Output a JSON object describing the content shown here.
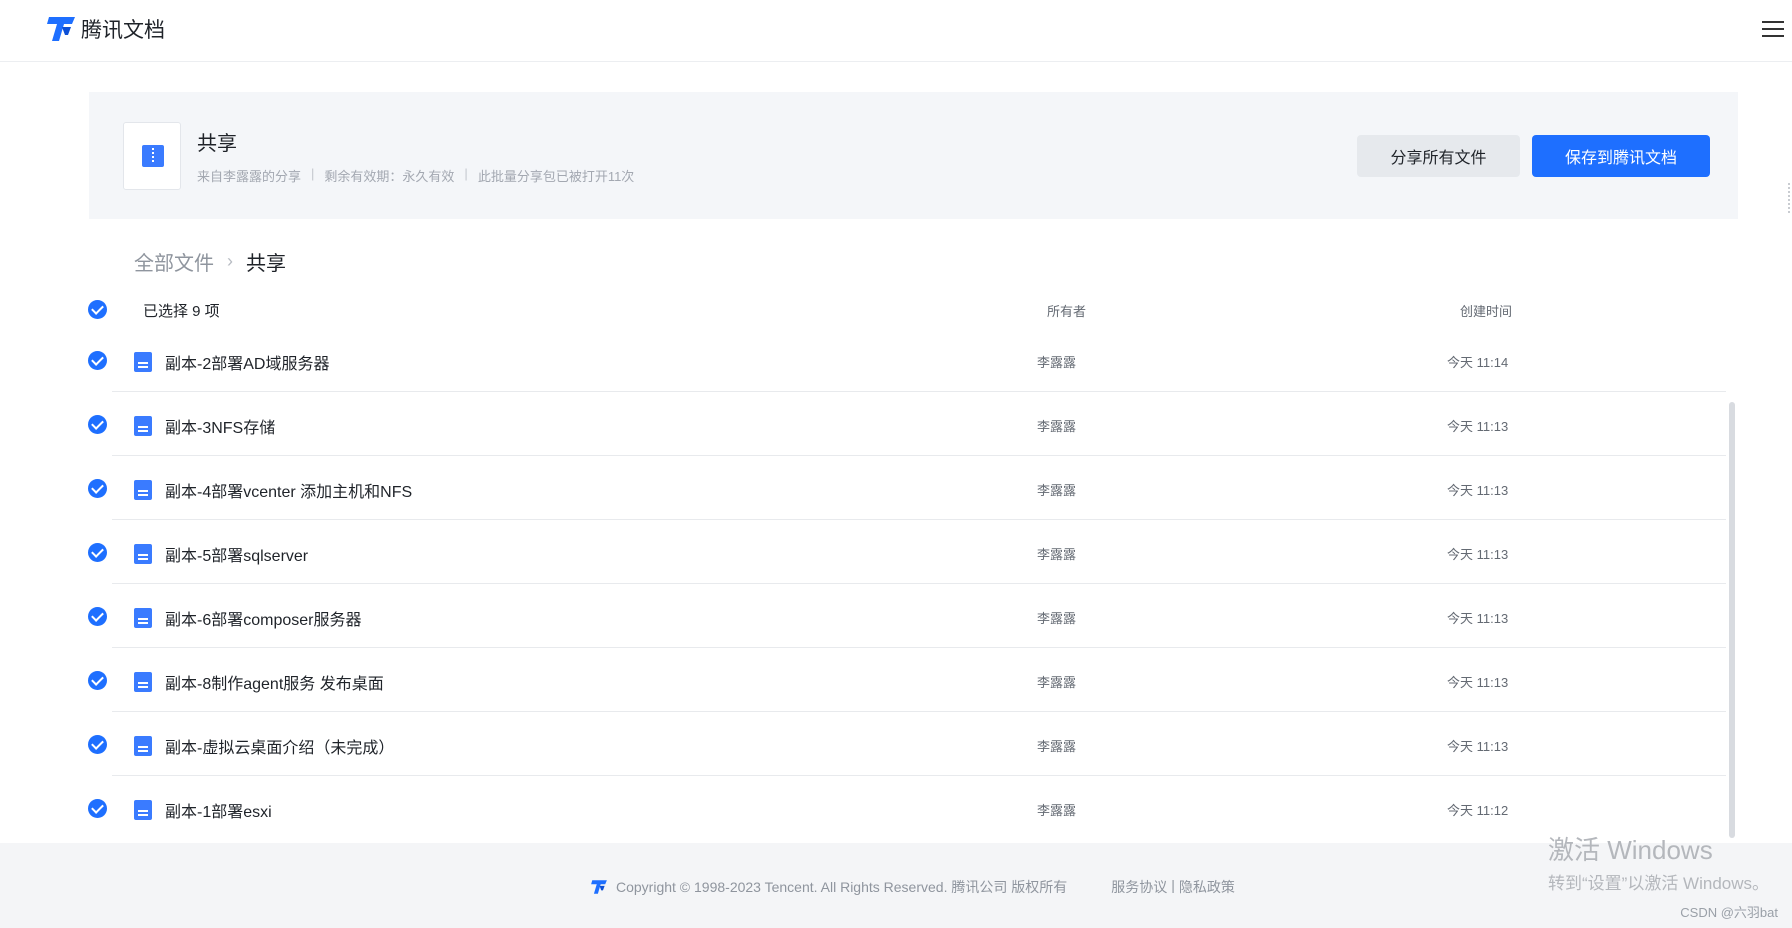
{
  "app": {
    "logo_text": "腾讯文档"
  },
  "share": {
    "title": "共享",
    "from": "来自李露露的分享",
    "validity": "剩余有效期：永久有效",
    "opened": "此批量分享包已被打开11次",
    "separator": "|",
    "btn_share_all": "分享所有文件",
    "btn_save": "保存到腾讯文档"
  },
  "breadcrumb": {
    "root": "全部文件",
    "separator": "›",
    "current": "共享"
  },
  "list": {
    "selected_label": "已选择 9 项",
    "col_owner": "所有者",
    "col_time": "创建时间",
    "rows": [
      {
        "name": "副本-2部署AD域服务器",
        "owner": "李露露",
        "time": "今天 11:14"
      },
      {
        "name": "副本-3NFS存储",
        "owner": "李露露",
        "time": "今天 11:13"
      },
      {
        "name": "副本-4部署vcenter 添加主机和NFS",
        "owner": "李露露",
        "time": "今天 11:13"
      },
      {
        "name": "副本-5部署sqlserver",
        "owner": "李露露",
        "time": "今天 11:13"
      },
      {
        "name": "副本-6部署composer服务器",
        "owner": "李露露",
        "time": "今天 11:13"
      },
      {
        "name": "副本-8制作agent服务 发布桌面",
        "owner": "李露露",
        "time": "今天 11:13"
      },
      {
        "name": "副本-虚拟云桌面介绍（未完成）",
        "owner": "李露露",
        "time": "今天 11:13"
      },
      {
        "name": "副本-1部署esxi",
        "owner": "李露露",
        "time": "今天 11:12"
      }
    ]
  },
  "footer": {
    "copyright": "Copyright © 1998-2023 Tencent. All Rights Reserved. 腾讯公司 版权所有",
    "terms": "服务协议",
    "divider": "|",
    "privacy": "隐私政策"
  },
  "overlay": {
    "activate_title": "激活 Windows",
    "activate_sub": "转到“设置”以激活 Windows。",
    "csdn": "CSDN @六羽bat"
  },
  "colors": {
    "primary": "#1e6fff",
    "doc_icon": "#3a7bff"
  },
  "icons": {
    "logo": "tencent-docs-logo-icon",
    "menu": "hamburger-menu-icon",
    "check": "check-circle-icon",
    "doc": "document-icon",
    "zip": "zip-file-icon"
  }
}
